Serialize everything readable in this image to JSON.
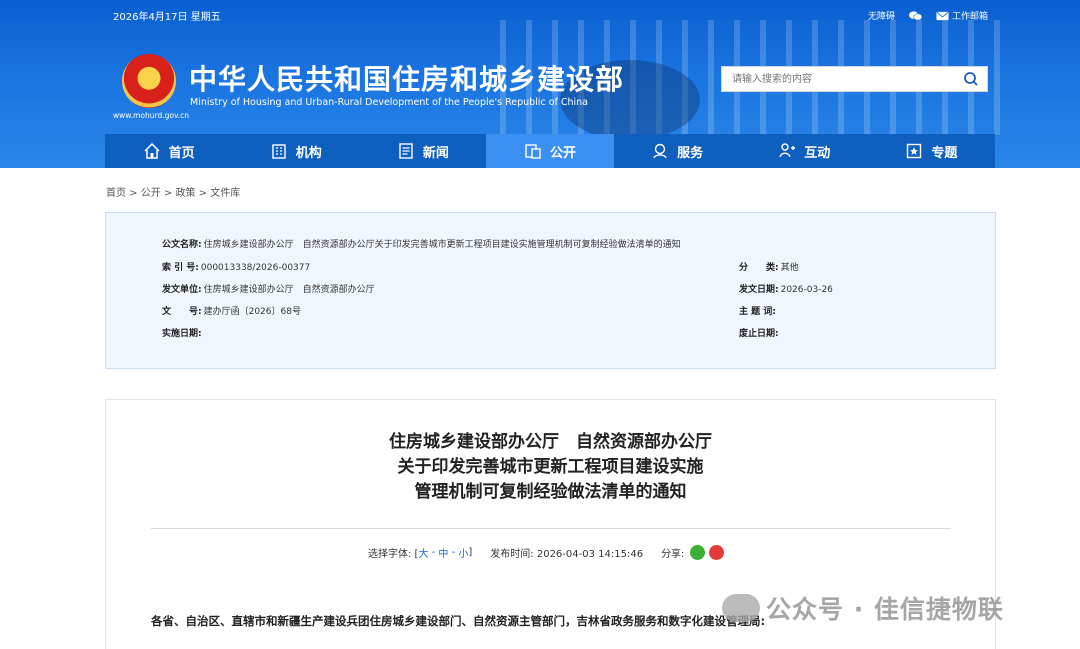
{
  "header": {
    "date": "2026年4月17日 星期五",
    "accessibility_link": "无障碍",
    "mailbox_link": "工作邮箱",
    "site_title": "中华人民共和国住房和城乡建设部",
    "site_subtitle_en": "Ministry of Housing and Urban-Rural Development of the People's Republic of China",
    "site_url": "www.mohurd.gov.cn",
    "search_placeholder": "请输入搜索的内容"
  },
  "nav": [
    {
      "label": "首页",
      "icon": "home-icon"
    },
    {
      "label": "机构",
      "icon": "building-icon"
    },
    {
      "label": "新闻",
      "icon": "news-icon"
    },
    {
      "label": "公开",
      "icon": "open-info-icon",
      "active": true
    },
    {
      "label": "服务",
      "icon": "service-icon"
    },
    {
      "label": "互动",
      "icon": "interaction-icon"
    },
    {
      "label": "专题",
      "icon": "topic-icon"
    }
  ],
  "breadcrumb": "首页 > 公开 > 政策 > 文件库",
  "meta": {
    "title_key": "公文名称:",
    "title_val": "住房城乡建设部办公厅　自然资源部办公厅关于印发完善城市更新工程项目建设实施管理机制可复制经验做法清单的通知",
    "index_key": "索 引 号:",
    "index_val": "000013338/2026-00377",
    "issuer_key": "发文单位:",
    "issuer_val": "住房城乡建设部办公厅　自然资源部办公厅",
    "docno_key": "文　　号:",
    "docno_val": "建办厅函〔2026〕68号",
    "impl_key": "实施日期:",
    "impl_val": "",
    "category_key": "分　　类:",
    "category_val": "其他",
    "date_key": "发文日期:",
    "date_val": "2026-03-26",
    "subject_key": "主 题 词:",
    "subject_val": "",
    "repeal_key": "废止日期:",
    "repeal_val": ""
  },
  "doc": {
    "title_line1": "住房城乡建设部办公厅　自然资源部办公厅",
    "title_line2": "关于印发完善城市更新工程项目建设实施",
    "title_line3": "管理机制可复制经验做法清单的通知",
    "font_label": "选择字体: [",
    "font_large": "大",
    "font_medium": "中",
    "font_small": "小",
    "font_close": "]",
    "publish_time": "发布时间: 2026-04-03 14:15:46",
    "share_label": "分享:",
    "salutation": "各省、自治区、直辖市和新疆生产建设兵团住房城乡建设部门、自然资源主管部门，吉林省政务服务和数字化建设管理局:"
  },
  "watermark": "公众号 · 佳信捷物联"
}
